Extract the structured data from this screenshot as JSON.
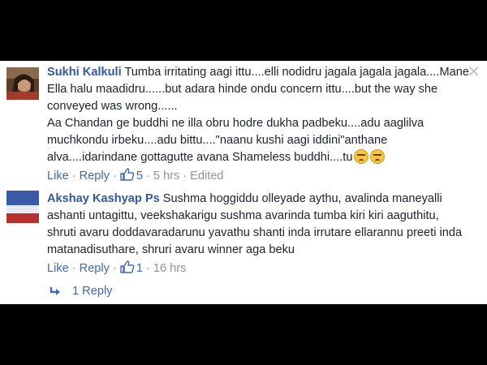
{
  "comments": [
    {
      "author": "Sukhi Kalkuli",
      "text": "Tumba irritating aagi ittu....elli nodidru jagala jagala jagala....Mane Ella halu maadidru......but adara hinde ondu concern ittu....but the way she conveyed was wrong......",
      "text2": "Aa Chandan ge buddhi ne illa obru hodre dukha padbeku....adu aaglilva muchkondu irbeku....adu bittu....\"naanu kushi aagi iddini\"anthane alva....idarindane gottagutte avana Shameless buddhi....tu",
      "emoji_icon": "angry-face-icon",
      "like_label": "Like",
      "reply_label": "Reply",
      "like_count": "5",
      "time": "5 hrs",
      "edited": "Edited"
    },
    {
      "author": "Akshay Kashyap Ps",
      "text": "Sushma hoggiddu olleyade aythu, avalinda maneyalli ashanti untagittu, veekshakarigu sushma avarinda tumba kiri kiri aaguthitu, shruti avaru doddavaradarunu yavathu shanti inda irrutare ellarannu preeti inda matanadisuthare, shruri avaru winner aga beku",
      "like_label": "Like",
      "reply_label": "Reply",
      "like_count": "1",
      "time": "16 hrs"
    }
  ],
  "replies": {
    "label": "1 Reply"
  },
  "colors": {
    "author": "#365899",
    "link": "#4267b2",
    "muted": "#90949c",
    "background": "#000000",
    "panel": "#ffffff"
  }
}
